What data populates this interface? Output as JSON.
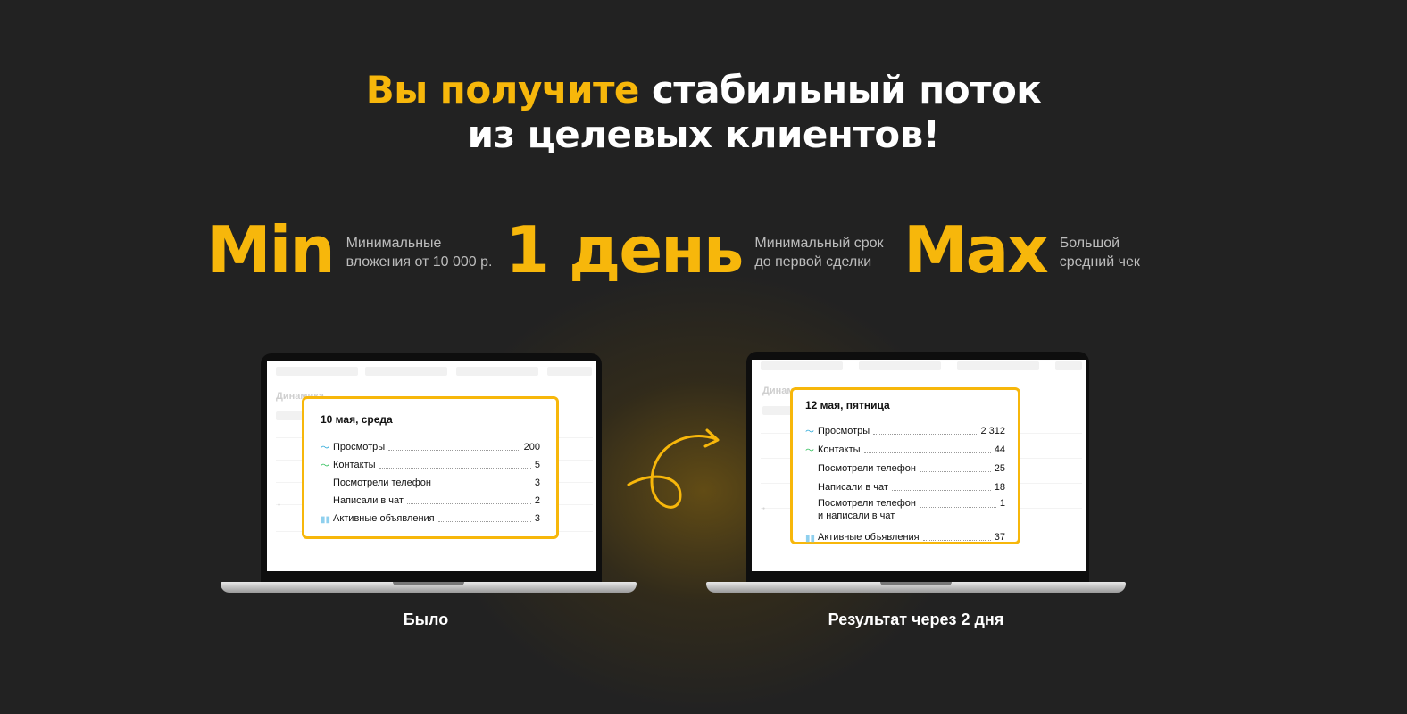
{
  "headline": {
    "line1_accent": "Вы получите",
    "line1_rest": " стабильный поток",
    "line2": "из целевых клиентов!"
  },
  "stats": [
    {
      "big": "Min",
      "desc": "Минимальные\nвложения от 10 000 р."
    },
    {
      "big": "1 день",
      "desc": "Минимальный срок\nдо первой сделки"
    },
    {
      "big": "Max",
      "desc": "Большой\nсредний чек"
    }
  ],
  "before": {
    "date": "10 мая, среда",
    "rows": [
      {
        "icon": "views-trend-icon",
        "label": "Просмотры",
        "value": "200"
      },
      {
        "icon": "contacts-trend-icon",
        "label": "Контакты",
        "value": "5"
      },
      {
        "icon": "",
        "label": "Посмотрели телефон",
        "value": "3"
      },
      {
        "icon": "",
        "label": "Написали в чат",
        "value": "2"
      },
      {
        "icon": "active-ads-bar-icon",
        "label": "Активные объявления",
        "value": "3"
      }
    ],
    "caption": "Было"
  },
  "after": {
    "date": "12 мая, пятница",
    "rows": [
      {
        "icon": "views-trend-icon",
        "label": "Просмотры",
        "value": "2 312"
      },
      {
        "icon": "contacts-trend-icon",
        "label": "Контакты",
        "value": "44"
      },
      {
        "icon": "",
        "label": "Посмотрели телефон",
        "value": "25"
      },
      {
        "icon": "",
        "label": "Написали в чат",
        "value": "18"
      },
      {
        "icon": "",
        "label": "Посмотрели телефон\nи написали в чат",
        "value": "1"
      },
      {
        "icon": "active-ads-bar-icon",
        "label": "Активные объявления",
        "value": "37"
      }
    ],
    "caption": "Результат через 2 дня"
  },
  "colors": {
    "background": "#222222",
    "accent": "#f7b70b",
    "views_icon": "#2aa8d8",
    "contacts_icon": "#2fbf5a",
    "ads_icon": "#8fd0ee"
  }
}
